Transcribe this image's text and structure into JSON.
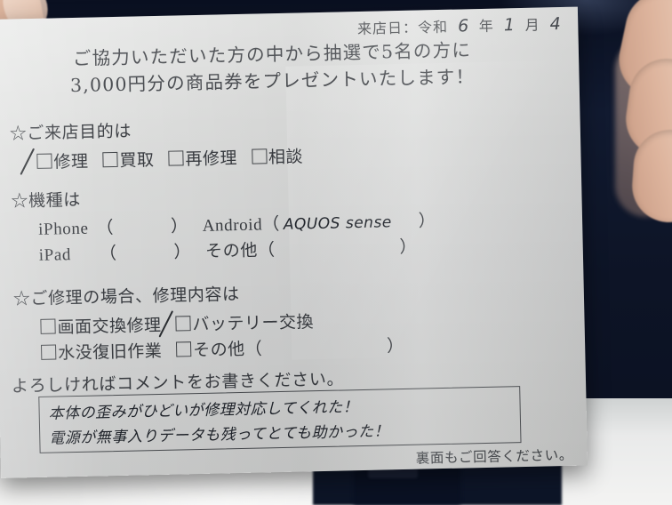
{
  "document": {
    "type": "customer-questionnaire",
    "date_line": {
      "label": "来店日：令和",
      "year_value": "6",
      "year_unit": "年",
      "month_value": "1",
      "month_unit": "月",
      "day_value": "4"
    },
    "headline": {
      "line1": "ご協力いただいた方の中から抽選で5名の方に",
      "line2": "3,000円分の商品券をプレゼントいたします！"
    },
    "sections": [
      {
        "id": "visit-purpose",
        "marker": "☆",
        "title": "ご来店目的は",
        "options": [
          {
            "label": "修理",
            "checked": true
          },
          {
            "label": "買取",
            "checked": false
          },
          {
            "label": "再修理",
            "checked": false
          },
          {
            "label": "相談",
            "checked": false
          }
        ]
      },
      {
        "id": "device-model",
        "marker": "☆",
        "title": "機種は",
        "fields": [
          {
            "label": "iPhone",
            "value": "",
            "open_paren": "（",
            "close_paren": "）"
          },
          {
            "label": "Android",
            "value": "AQUOS sense",
            "open_paren": "（",
            "close_paren": "）"
          },
          {
            "label": "iPad",
            "value": "",
            "open_paren": "（",
            "close_paren": "）"
          },
          {
            "label": "その他",
            "value": "",
            "open_paren": "（",
            "close_paren": "）"
          }
        ]
      },
      {
        "id": "repair-content",
        "marker": "☆",
        "title": "ご修理の場合、修理内容は",
        "options": [
          {
            "label": "画面交換修理",
            "checked": false
          },
          {
            "label": "バッテリー交換",
            "checked": true
          },
          {
            "label": "水没復旧作業",
            "checked": false
          },
          {
            "label": "その他",
            "checked": false,
            "has_blank": true,
            "open_paren": "（",
            "close_paren": "）",
            "value": ""
          }
        ]
      }
    ],
    "comment": {
      "prompt": "よろしければコメントをお書きください。",
      "lines": [
        "本体の歪みがひどいが修理対応してくれた！",
        "電源が無事入りデータも残ってとても助かった！"
      ]
    },
    "footnote": "裏面もご回答ください。",
    "colors": {
      "paper": "#dcdddc",
      "ink": "#383b40",
      "handwriting": "#20242b",
      "background": "#0d1426",
      "skin": "#d9b099"
    }
  }
}
